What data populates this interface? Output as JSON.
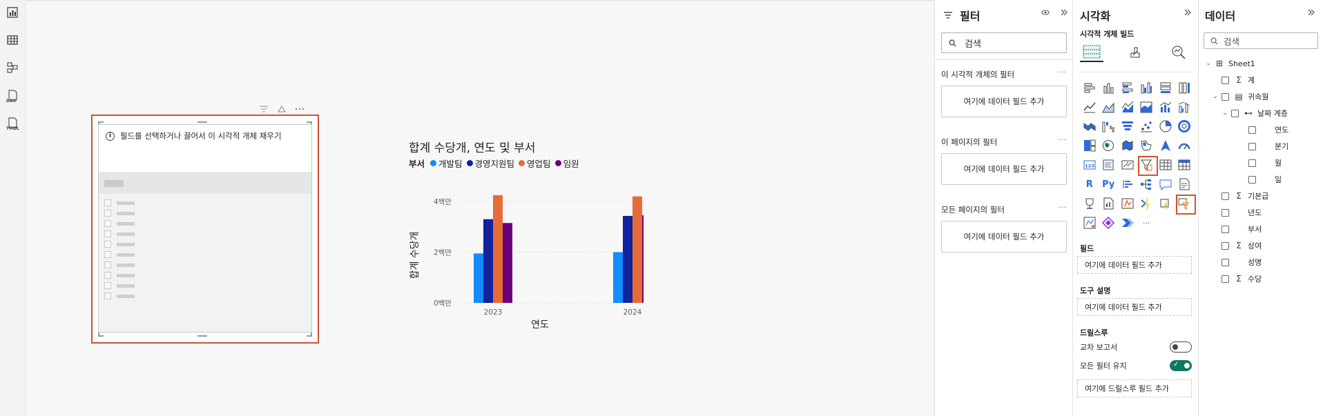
{
  "canvas": {
    "slicer": {
      "message": "필드를 선택하거나 끌어서 이 시각적 개체 채우기",
      "info_icon": "i"
    }
  },
  "chart_data": {
    "type": "bar",
    "title": "합계 수당개, 연도 및 부서",
    "legend_title": "부서",
    "xlabel": "연도",
    "ylabel": "합계 수당개",
    "categories": [
      "2023",
      "2024"
    ],
    "ylim": [
      0,
      4300000
    ],
    "yticks": [
      {
        "value": 0,
        "label": "0백만"
      },
      {
        "value": 2000000,
        "label": "2백만"
      },
      {
        "value": 4000000,
        "label": "4백만"
      }
    ],
    "series": [
      {
        "name": "개발팀",
        "color": "#118DFF",
        "values": [
          1950000,
          2000000
        ]
      },
      {
        "name": "경영지원팀",
        "color": "#12239E",
        "values": [
          3300000,
          3430000
        ]
      },
      {
        "name": "영업팀",
        "color": "#E66C37",
        "values": [
          4250000,
          4200000
        ]
      },
      {
        "name": "임원",
        "color": "#6B007B",
        "values": [
          3150000,
          3460000
        ]
      }
    ],
    "grid": true
  },
  "filter_pane": {
    "title": "필터",
    "search_placeholder": "검색",
    "sections": [
      {
        "title": "이 시각적 개체의 필터",
        "drop": "여기에 데이터 필드 추가"
      },
      {
        "title": "이 페이지의 필터",
        "drop": "여기에 데이터 필드 추가"
      },
      {
        "title": "모든 페이지의 필터",
        "drop": "여기에 데이터 필드 추가"
      }
    ],
    "more": "···"
  },
  "viz_pane": {
    "title": "시각화",
    "subtitle": "시각적 개체 빌드",
    "field_title": "필드",
    "field_drop": "여기에 데이터 필드 추가",
    "tooltip_title": "도구 설명",
    "tooltip_drop": "여기에 데이터 필드 추가",
    "drill_title": "드릴스루",
    "cross_report": "교차 보고서",
    "keep_filters": "모든 필터 유지",
    "drill_drop": "여기에 드릴스루 필드 추가",
    "r_label": "R",
    "py_label": "Py",
    "more": "···"
  },
  "data_pane": {
    "title": "데이터",
    "search_placeholder": "검색",
    "tree": [
      {
        "label": "Sheet1",
        "level": 0,
        "icon": "table-icon",
        "chevron": "down",
        "checkbox": false
      },
      {
        "label": "계",
        "level": 1,
        "icon": "sigma-icon",
        "checkbox": true
      },
      {
        "label": "귀속월",
        "level": 1,
        "icon": "calendar-icon",
        "chevron": "down",
        "checkbox": true
      },
      {
        "label": "날짜 계층",
        "level": 2,
        "icon": "hierarchy-icon",
        "chevron": "down",
        "checkbox": true
      },
      {
        "label": "연도",
        "level": 3,
        "icon": "",
        "checkbox": true
      },
      {
        "label": "분기",
        "level": 3,
        "icon": "",
        "checkbox": true
      },
      {
        "label": "월",
        "level": 3,
        "icon": "",
        "checkbox": true
      },
      {
        "label": "일",
        "level": 3,
        "icon": "",
        "checkbox": true
      },
      {
        "label": "기본급",
        "level": 1,
        "icon": "sigma-icon",
        "checkbox": true
      },
      {
        "label": "년도",
        "level": 1,
        "icon": "",
        "checkbox": true
      },
      {
        "label": "부서",
        "level": 1,
        "icon": "",
        "checkbox": true
      },
      {
        "label": "상여",
        "level": 1,
        "icon": "sigma-icon",
        "checkbox": true
      },
      {
        "label": "성명",
        "level": 1,
        "icon": "",
        "checkbox": true
      },
      {
        "label": "수당",
        "level": 1,
        "icon": "sigma-icon",
        "checkbox": true
      }
    ]
  },
  "rail": {
    "dax_label": "DAX",
    "tmdl_label": "TMDL"
  }
}
